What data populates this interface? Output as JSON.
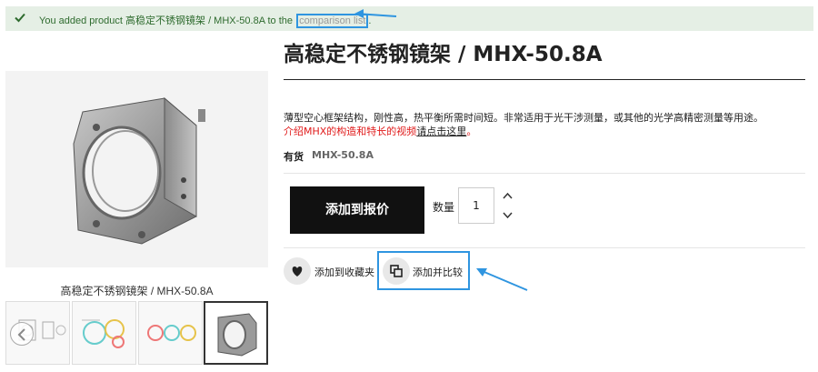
{
  "banner": {
    "message": "You added product 高稳定不锈钢镜架 / MHX-50.8A to the ",
    "link_text": "comparison list",
    "end": ".",
    "icon": "check-icon"
  },
  "gallery": {
    "caption": "高稳定不锈钢镜架 / MHX-50.8A",
    "thumbs": [
      "thumbnail-1",
      "thumbnail-2",
      "thumbnail-3",
      "thumbnail-4"
    ],
    "active_thumb": 4
  },
  "product": {
    "title": "高稳定不锈钢镜架 / MHX-50.8A",
    "description": "薄型空心框架结构，刚性高，热平衡所需时间短。非常适用于光干涉测量，或其他的光学高精密测量等用途。",
    "video_text": "介绍MHX的构造和特长的视频",
    "video_link": "请点击这里",
    "video_end": "。",
    "stock": "有货",
    "sku": "MHX-50.8A"
  },
  "actions": {
    "quote_button": "添加到报价",
    "qty_label": "数量",
    "qty_value": "1",
    "wishlist": "添加到收藏夹",
    "compare": "添加并比较"
  },
  "colors": {
    "banner_bg": "#e5efe5",
    "banner_text": "#2e6b2e",
    "highlight": "#2f95e0",
    "link_red": "#e01a1a"
  }
}
